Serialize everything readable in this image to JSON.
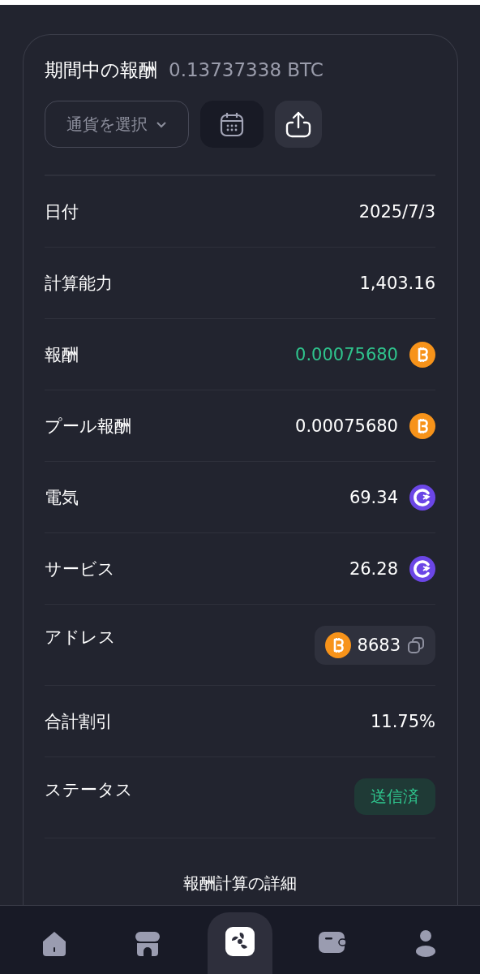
{
  "header": {
    "title": "期間中の報酬",
    "total": "0.13737338 BTC"
  },
  "toolbar": {
    "currency_select": {
      "placeholder": "通貨を選択"
    }
  },
  "rows": [
    {
      "kind": "text",
      "label": "日付",
      "value": "2025/7/3"
    },
    {
      "kind": "text",
      "label": "計算能力",
      "value": "1,403.16"
    },
    {
      "kind": "coin",
      "label": "報酬",
      "value": "0.00075680",
      "icon": {
        "kind": "btc"
      },
      "highlight": true
    },
    {
      "kind": "coin",
      "label": "プール報酬",
      "value": "0.00075680",
      "icon": {
        "kind": "btc"
      },
      "highlight": false
    },
    {
      "kind": "coin",
      "label": "電気",
      "value": "69.34",
      "icon": {
        "kind": "gc"
      },
      "highlight": false
    },
    {
      "kind": "coin",
      "label": "サービス",
      "value": "26.28",
      "icon": {
        "kind": "gc"
      },
      "highlight": false
    },
    {
      "kind": "address",
      "label": "アドレス",
      "value": "8683",
      "icon": {
        "kind": "btc"
      }
    },
    {
      "kind": "text",
      "label": "合計割引",
      "value": "11.75%"
    },
    {
      "kind": "status",
      "label": "ステータス",
      "value": "送信済"
    }
  ],
  "details_link": "報酬計算の詳細",
  "nav": [
    {
      "kind": "home",
      "selected": false
    },
    {
      "kind": "store",
      "selected": false
    },
    {
      "kind": "fan",
      "selected": true
    },
    {
      "kind": "wallet",
      "selected": false
    },
    {
      "kind": "profile",
      "selected": false
    }
  ]
}
